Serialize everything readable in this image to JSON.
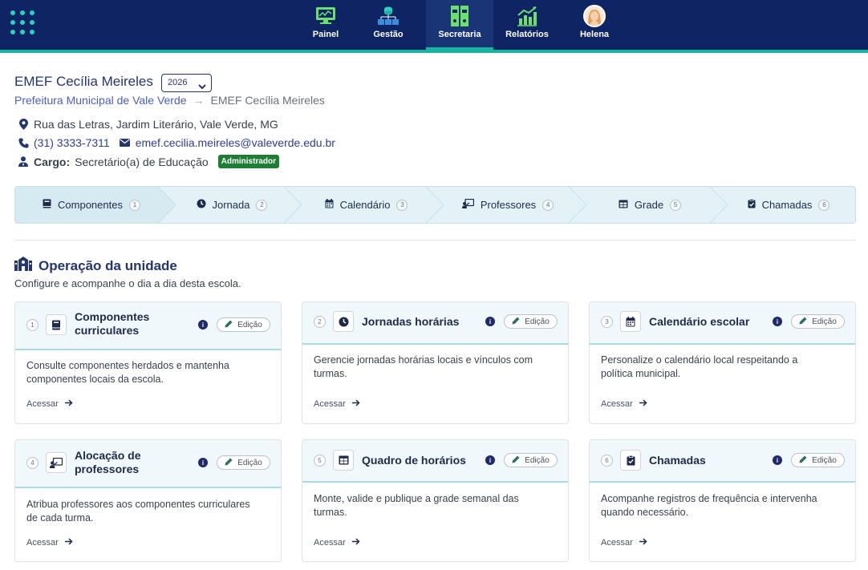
{
  "topbar": {
    "nav": [
      {
        "label": "Painel",
        "icon": "monitor-icon"
      },
      {
        "label": "Gestão",
        "icon": "network-icon"
      },
      {
        "label": "Secretaria",
        "icon": "binders-icon"
      },
      {
        "label": "Relatórios",
        "icon": "chart-icon"
      },
      {
        "label": "Helena",
        "icon": "avatar"
      }
    ],
    "active": "Secretaria",
    "colors": {
      "bar": "#0f2563",
      "accent": "#19b3a3",
      "icon_green": "#6be06b"
    }
  },
  "header": {
    "school_name": "EMEF Cecília Meireles",
    "year": "2026",
    "breadcrumb": {
      "parent": "Prefeitura Municipal de Vale Verde",
      "separator": "→",
      "current": "EMEF Cecília Meireles"
    },
    "address": "Rua das Letras, Jardim Literário, Vale Verde, MG",
    "phone": "(31) 3333-7311",
    "email": "emef.cecilia.meireles@valeverde.edu.br",
    "role_label": "Cargo:",
    "role_value": "Secretário(a) de Educação",
    "role_badge": "Administrador"
  },
  "stepper": [
    {
      "label": "Componentes",
      "num": "1",
      "icon": "book-icon"
    },
    {
      "label": "Jornada",
      "num": "2",
      "icon": "clock-icon"
    },
    {
      "label": "Calendário",
      "num": "3",
      "icon": "calendar-icon"
    },
    {
      "label": "Professores",
      "num": "4",
      "icon": "teacher-icon"
    },
    {
      "label": "Grade",
      "num": "5",
      "icon": "grid-icon"
    },
    {
      "label": "Chamadas",
      "num": "6",
      "icon": "clipboard-check-icon"
    }
  ],
  "section": {
    "title": "Operação da unidade",
    "subtitle": "Configure e acompanhe o dia a dia desta escola."
  },
  "cards": [
    {
      "num": "1",
      "title_l1": "Componentes",
      "title_l2": "curriculares",
      "desc_l1": "Consulte componentes herdados e mantenha",
      "desc_l2": "componentes locais da escola.",
      "edit": "Edição",
      "link": "Acessar",
      "icon": "book-icon"
    },
    {
      "num": "2",
      "title_l1": "Jornadas horárias",
      "title_l2": "",
      "desc_l1": "Gerencie jornadas horárias locais e vínculos com",
      "desc_l2": "turmas.",
      "edit": "Edição",
      "link": "Acessar",
      "icon": "clock-icon"
    },
    {
      "num": "3",
      "title_l1": "Calendário escolar",
      "title_l2": "",
      "desc_l1": "Personalize o calendário local respeitando a",
      "desc_l2": "política municipal.",
      "edit": "Edição",
      "link": "Acessar",
      "icon": "calendar-icon"
    },
    {
      "num": "4",
      "title_l1": "Alocação de",
      "title_l2": "professores",
      "desc_l1": "Atribua professores aos componentes curriculares",
      "desc_l2": "de cada turma.",
      "edit": "Edição",
      "link": "Acessar",
      "icon": "teacher-icon"
    },
    {
      "num": "5",
      "title_l1": "Quadro de horários",
      "title_l2": "",
      "desc_l1": "Monte, valide e publique a grade semanal das",
      "desc_l2": "turmas.",
      "edit": "Edição",
      "link": "Acessar",
      "icon": "grid-icon"
    },
    {
      "num": "6",
      "title_l1": "Chamadas",
      "title_l2": "",
      "desc_l1": "Acompanhe registros de frequência e intervenha",
      "desc_l2": "quando necessário.",
      "edit": "Edição",
      "link": "Acessar",
      "icon": "clipboard-check-icon"
    }
  ]
}
